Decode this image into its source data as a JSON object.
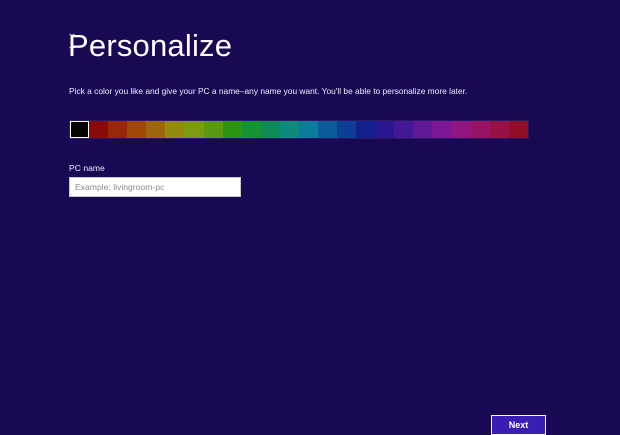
{
  "page": {
    "title": "Personalize",
    "description": "Pick a color you like and give your PC a name–any name you want. You'll be able to personalize more later."
  },
  "color_picker": {
    "selected_index": 0,
    "swatches": [
      "#050505",
      "#8a0a0a",
      "#962a08",
      "#a0470a",
      "#9c660c",
      "#938a0e",
      "#7b9a10",
      "#5a9a12",
      "#2c9612",
      "#169232",
      "#108a58",
      "#0e8a7c",
      "#0c7c9a",
      "#0c5c9a",
      "#0c3e96",
      "#12208e",
      "#2a1690",
      "#441894",
      "#601896",
      "#7c1896",
      "#901680",
      "#961462",
      "#961244",
      "#900e26"
    ]
  },
  "pc_name": {
    "label": "PC name",
    "placeholder": "Example: livingroom-pc",
    "value": ""
  },
  "footer": {
    "next_label": "Next"
  },
  "colors": {
    "background": "#190853",
    "button_background": "#3a1db3",
    "text": "#ffffff"
  }
}
